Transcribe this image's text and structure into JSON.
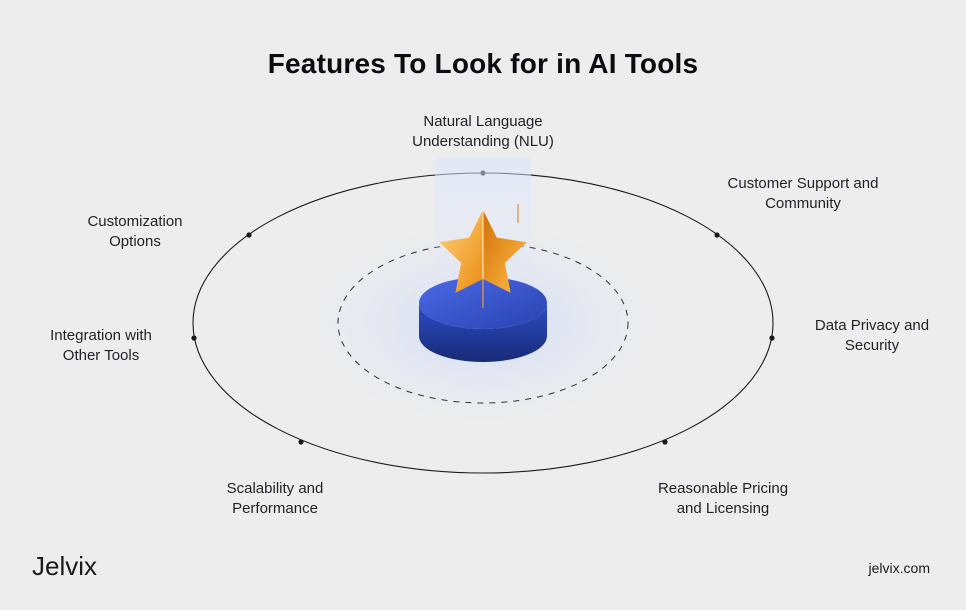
{
  "title": "Features To Look for in AI Tools",
  "features": [
    {
      "label": "Natural Language\nUnderstanding (NLU)"
    },
    {
      "label": "Customer Support and\nCommunity"
    },
    {
      "label": "Data Privacy and\nSecurity"
    },
    {
      "label": "Reasonable Pricing\nand Licensing"
    },
    {
      "label": "Scalability and\nPerformance"
    },
    {
      "label": "Integration with\nOther Tools"
    },
    {
      "label": "Customization\nOptions"
    }
  ],
  "brand": {
    "name": "Jelvix",
    "url": "jelvix.com"
  },
  "colors": {
    "accent_star": "#f59e0b",
    "accent_disk": "#2d4ec7",
    "background": "#ededed"
  }
}
